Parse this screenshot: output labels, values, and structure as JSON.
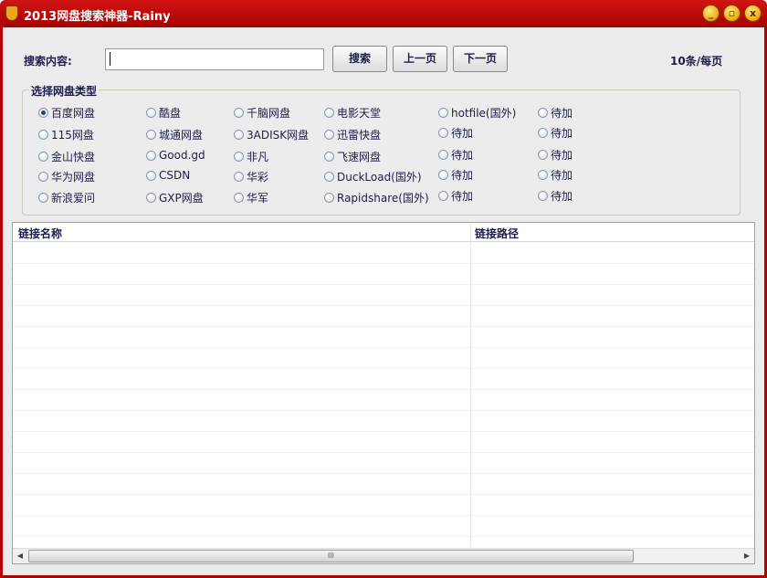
{
  "window": {
    "title": "2013网盘搜索神器-Rainy"
  },
  "search": {
    "label": "搜索内容:",
    "value": "",
    "search_button": "搜索",
    "prev_button": "上一页",
    "next_button": "下一页",
    "per_page": "10条/每页"
  },
  "group": {
    "title": "选择网盘类型",
    "columns": [
      [
        "百度网盘",
        "115网盘",
        "金山快盘",
        "华为网盘",
        "新浪爱问"
      ],
      [
        "酷盘",
        "城通网盘",
        "Good.gd",
        "CSDN",
        "GXP网盘"
      ],
      [
        "千脑网盘",
        "3ADISK网盘",
        "非凡",
        "华彩",
        "华军"
      ],
      [
        "电影天堂",
        "迅雷快盘",
        "飞速网盘",
        "DuckLoad(国外)",
        "Rapidshare(国外)"
      ],
      [
        "hotfile(国外)",
        "待加",
        "待加",
        "待加",
        "待加"
      ],
      [
        "待加",
        "待加",
        "待加",
        "待加",
        "待加"
      ]
    ],
    "selected": "百度网盘"
  },
  "table": {
    "columns": [
      "链接名称",
      "链接路径"
    ],
    "rows": []
  },
  "scrollbar": {
    "thumb_grip": "III"
  }
}
